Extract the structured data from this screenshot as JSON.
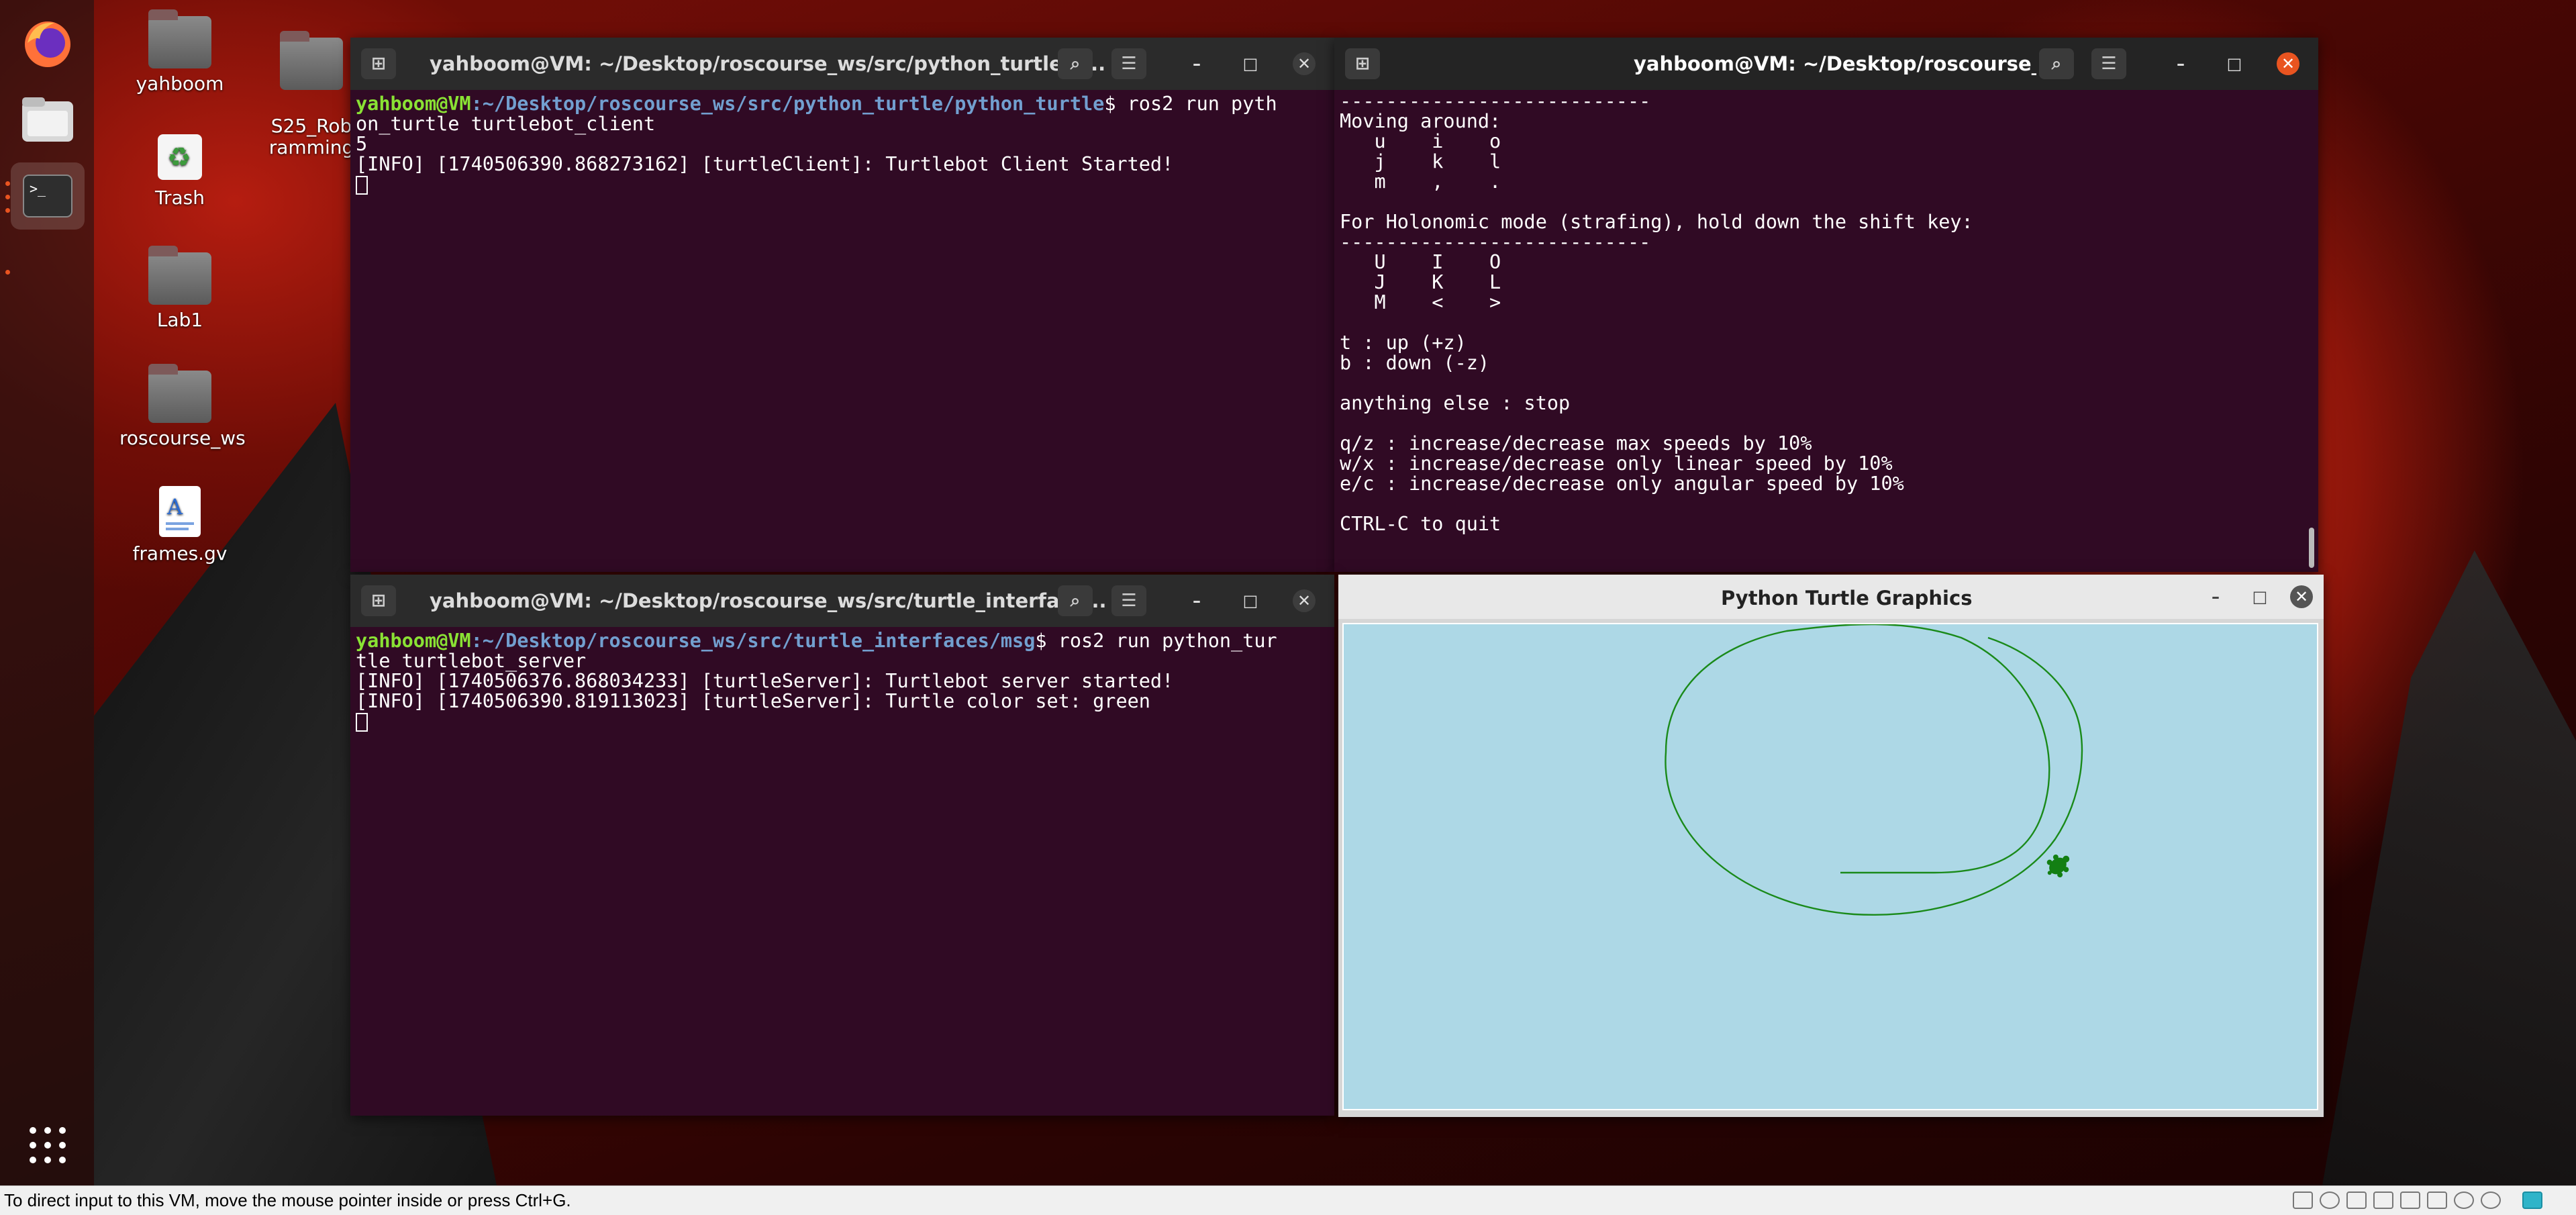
{
  "desktop_icons": [
    {
      "label": "yahboom"
    },
    {
      "label": "S25_Rob\nramming"
    },
    {
      "label": "Trash"
    },
    {
      "label": "Lab1"
    },
    {
      "label": "roscourse_ws"
    },
    {
      "label": "frames.gv"
    }
  ],
  "terminal_client": {
    "title": "yahboom@VM: ~/Desktop/roscourse_ws/src/python_turtle/p...",
    "prompt_user": "yahboom@VM",
    "prompt_path": ":~/Desktop/roscourse_ws/src/python_turtle/python_turtle",
    "prompt_cmd": "$ ros2 run pyth",
    "lines": [
      "on_turtle turtlebot_client",
      "5",
      "[INFO] [1740506390.868273162] [turtleClient]: Turtlebot Client Started!"
    ]
  },
  "terminal_teleop": {
    "title": "yahboom@VM: ~/Desktop/roscourse_ws",
    "lines": [
      "---------------------------",
      "Moving around:",
      "   u    i    o",
      "   j    k    l",
      "   m    ,    .",
      "",
      "For Holonomic mode (strafing), hold down the shift key:",
      "---------------------------",
      "   U    I    O",
      "   J    K    L",
      "   M    <    >",
      "",
      "t : up (+z)",
      "b : down (-z)",
      "",
      "anything else : stop",
      "",
      "q/z : increase/decrease max speeds by 10%",
      "w/x : increase/decrease only linear speed by 10%",
      "e/c : increase/decrease only angular speed by 10%",
      "",
      "CTRL-C to quit"
    ]
  },
  "terminal_server": {
    "title": "yahboom@VM: ~/Desktop/roscourse_ws/src/turtle_interface...",
    "prompt_user": "yahboom@VM",
    "prompt_path": ":~/Desktop/roscourse_ws/src/turtle_interfaces/msg",
    "prompt_cmd": "$ ros2 run python_tur",
    "lines": [
      "tle turtlebot_server",
      "[INFO] [1740506376.868034233] [turtleServer]: Turtlebot server started!",
      "[INFO] [1740506390.819113023] [turtleServer]: Turtle color set: green"
    ]
  },
  "turtle_window": {
    "title": "Python Turtle Graphics",
    "canvas_color": "#add8e6",
    "pen_color": "green"
  },
  "statusbar": {
    "text": "To direct input to this VM, move the mouse pointer inside or press Ctrl+G."
  },
  "icons": {
    "dock": [
      "firefox-icon",
      "files-icon",
      "terminal-icon",
      "apps-grid-icon"
    ],
    "titlebar": [
      "new-tab-icon",
      "search-icon",
      "menu-icon",
      "minimize-icon",
      "maximize-icon",
      "close-icon"
    ]
  },
  "colors": {
    "terminal_bg": "#300a24",
    "prompt_user": "#8ae234",
    "prompt_path": "#729fcf",
    "close_active": "#e95420"
  }
}
